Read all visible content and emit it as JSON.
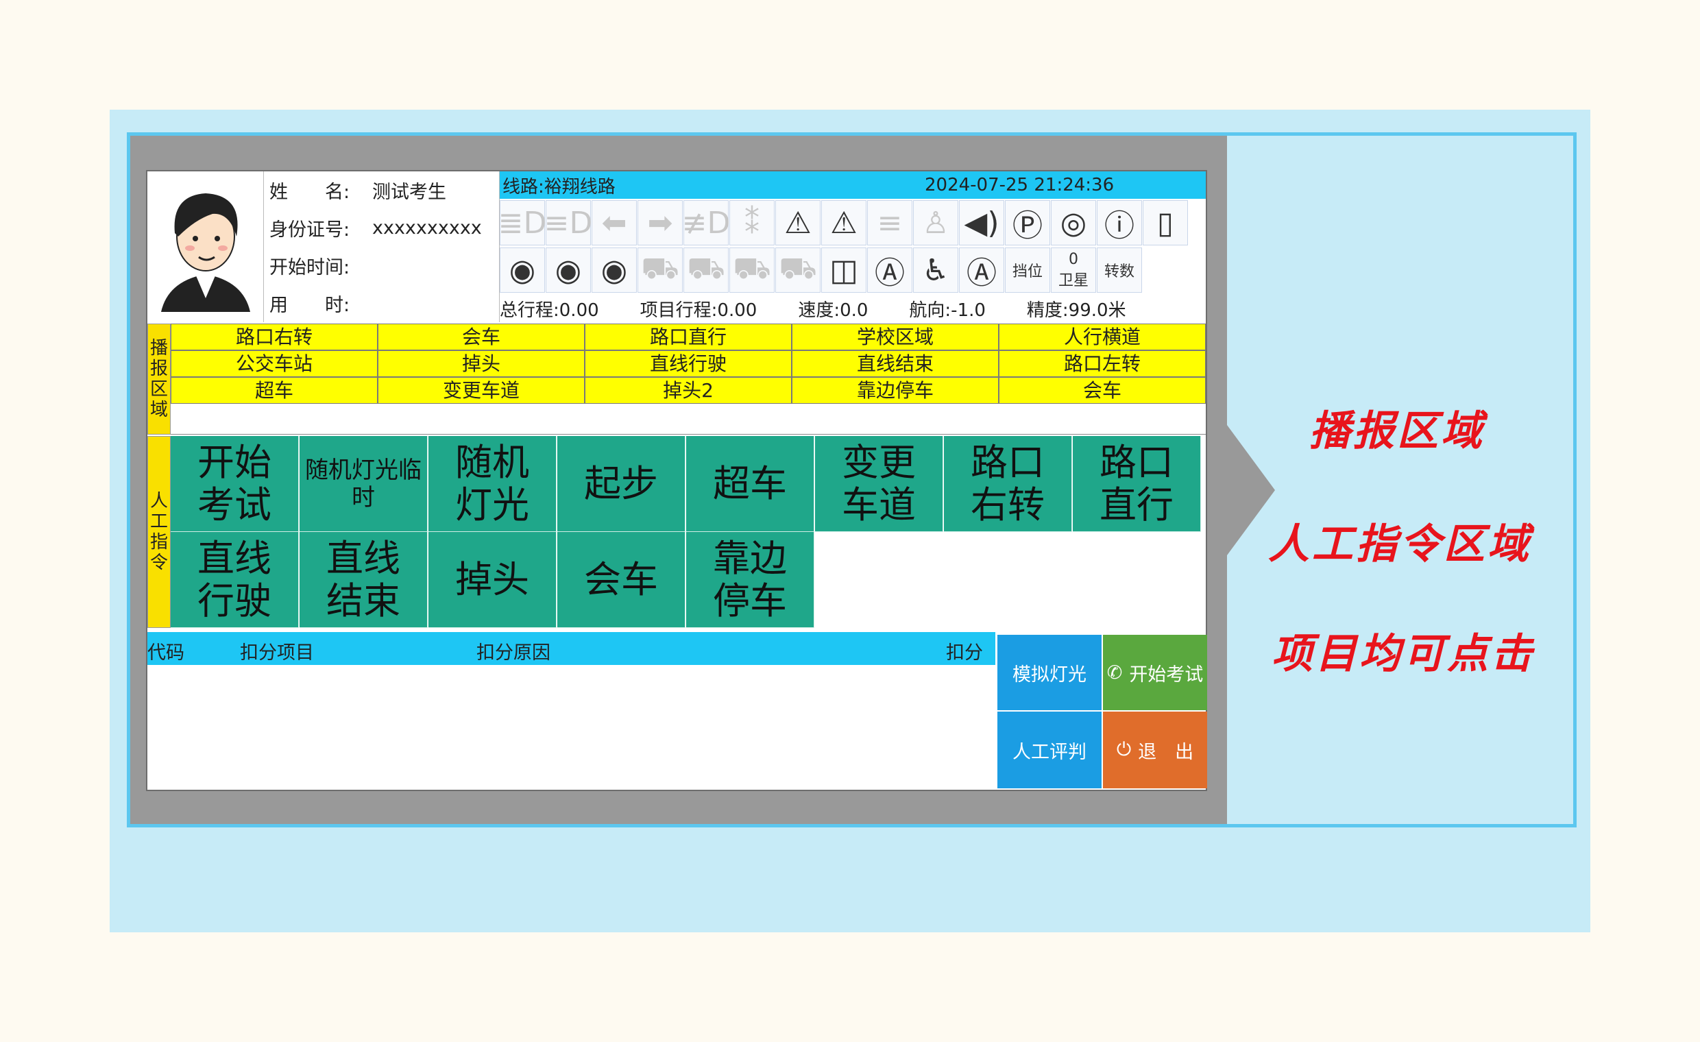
{
  "student": {
    "name_label": "姓　　名:",
    "name": "测试考生",
    "id_label": "身份证号:",
    "id": "xxxxxxxxxx",
    "start_label": "开始时间:",
    "start": "",
    "used_label": "用　　时:",
    "used": ""
  },
  "route": {
    "label": "线路:裕翔线路",
    "datetime": "2024-07-25 21:24:36"
  },
  "status_icons_row1": [
    {
      "icon": "high-beam-icon",
      "glyph": "≣D",
      "dim": true
    },
    {
      "icon": "low-beam-icon",
      "glyph": "≡D",
      "dim": true
    },
    {
      "icon": "left-turn-icon",
      "glyph": "⬅",
      "dim": true
    },
    {
      "icon": "right-turn-icon",
      "glyph": "➡",
      "dim": true
    },
    {
      "icon": "fog-light-icon",
      "glyph": "≢D",
      "dim": true
    },
    {
      "icon": "rear-fog-icon",
      "glyph": "⁑",
      "dim": true
    },
    {
      "icon": "hazard-icon",
      "glyph": "⚠",
      "dim": false
    },
    {
      "icon": "hazard-warning-icon",
      "glyph": "⚠",
      "dim": false
    },
    {
      "icon": "position-light-icon",
      "glyph": "≡",
      "dim": true
    },
    {
      "icon": "seatbelt-icon",
      "glyph": "♙",
      "dim": true
    },
    {
      "icon": "horn-icon",
      "glyph": "◀)",
      "dim": false
    },
    {
      "icon": "parking-brake-icon",
      "glyph": "Ⓟ",
      "dim": false
    },
    {
      "icon": "brake-icon",
      "glyph": "◎",
      "dim": false
    },
    {
      "icon": "engine-temp-icon",
      "glyph": "ⓘ",
      "dim": false
    },
    {
      "icon": "door-icon",
      "glyph": "▯",
      "dim": false
    }
  ],
  "status_icons_row2": [
    {
      "icon": "gauge-1-icon",
      "glyph": "◉",
      "dim": false
    },
    {
      "icon": "gauge-2-icon",
      "glyph": "◉",
      "dim": false
    },
    {
      "icon": "gauge-3-icon",
      "glyph": "◉",
      "dim": false
    },
    {
      "icon": "car-1-icon",
      "glyph": "⛟",
      "dim": true
    },
    {
      "icon": "car-2-icon",
      "glyph": "⛟",
      "dim": true
    },
    {
      "icon": "car-3-icon",
      "glyph": "⛟",
      "dim": true
    },
    {
      "icon": "car-4-icon",
      "glyph": "⛟",
      "dim": true
    },
    {
      "icon": "mirror-icon",
      "glyph": "◫",
      "dim": false
    },
    {
      "icon": "auto-a-icon",
      "glyph": "Ⓐ",
      "dim": false
    },
    {
      "icon": "seat-icon",
      "glyph": "♿",
      "dim": false
    },
    {
      "icon": "auto-b-icon",
      "glyph": "Ⓐ",
      "dim": false
    }
  ],
  "gear": {
    "label": "挡位",
    "value": ""
  },
  "satellite": {
    "label": "卫星",
    "value": "0"
  },
  "rpm": {
    "label": "转数",
    "value": ""
  },
  "stats": {
    "total": "总行程:0.00",
    "project": "项目行程:0.00",
    "speed": "速度:0.0",
    "heading": "航向:-1.0",
    "accuracy": "精度:99.0米"
  },
  "broadcast_label": "播报区域",
  "broadcast_items": [
    "路口右转",
    "会车",
    "路口直行",
    "学校区域",
    "人行横道",
    "公交车站",
    "掉头",
    "直线行驶",
    "直线结束",
    "路口左转",
    "超车",
    "变更车道",
    "掉头2",
    "靠边停车",
    "会车"
  ],
  "commands_label": "人工指令",
  "commands": [
    "开始\n考试",
    "随机灯光临时",
    "随机\n灯光",
    "起步",
    "超车",
    "变更\n车道",
    "路口\n右转",
    "路口\n直行",
    "直线\n行驶",
    "直线\n结束",
    "掉头",
    "会车",
    "靠边\n停车"
  ],
  "deduction_headers": {
    "code": "代码",
    "item": "扣分项目",
    "reason": "扣分原因",
    "score": "扣分"
  },
  "buttons": {
    "simulate_lights": "模拟灯光",
    "start_exam": "开始考试",
    "manual_judge": "人工评判",
    "exit": "退　出"
  },
  "callouts": {
    "line1": "播报区域",
    "line2": "人工指令区域",
    "line3": "项目均可点击"
  },
  "colors": {
    "accent_blue": "#1ec6f4",
    "broadcast_yellow": "#ffff00",
    "command_green": "#1fa78a",
    "callout_red": "#e8141c"
  }
}
